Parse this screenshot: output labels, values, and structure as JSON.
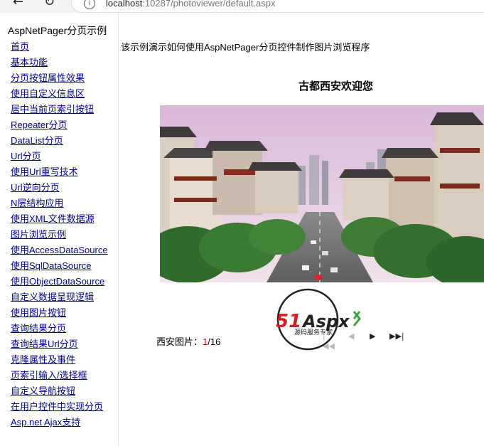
{
  "browser": {
    "url_host": "localhost",
    "url_path": ":10287/photoviewer/default.aspx"
  },
  "sidebar": {
    "title": "AspNetPager分页示例",
    "items": [
      "首页",
      "基本功能",
      "分页按钮属性效果",
      "使用自定义信息区",
      "居中当前页索引按钮",
      "Repeater分页",
      "DataList分页",
      "Url分页",
      "使用Url重写技术",
      "Url逆向分页",
      "N层结构应用",
      "使用XML文件数据源",
      "图片浏览示例",
      "使用AccessDataSource",
      "使用SqlDataSource",
      "使用ObjectDataSource",
      "自定义数据呈现逻辑",
      "使用图片按钮",
      "查询结果分页",
      "查询结果Url分页",
      "克隆属性及事件",
      "页索引输入/选择框",
      "自定义导航按钮",
      "在用户控件中实现分页",
      "Asp.net Ajax支持"
    ]
  },
  "main": {
    "intro": "该示例演示如何使用AspNetPager分页控件制作图片浏览程序",
    "photo_caption": "古都西安欢迎您"
  },
  "pager": {
    "label": "西安图片：",
    "current": "1",
    "separator": "/",
    "total": "16"
  },
  "watermark": {
    "brand_51": "51",
    "brand_aspx": "Aspx",
    "tagline": "源码服务专家"
  },
  "colors": {
    "link": "#00008b",
    "current_page": "#cc0000",
    "brand_red": "#d61f26",
    "brand_green": "#3aa63a"
  }
}
